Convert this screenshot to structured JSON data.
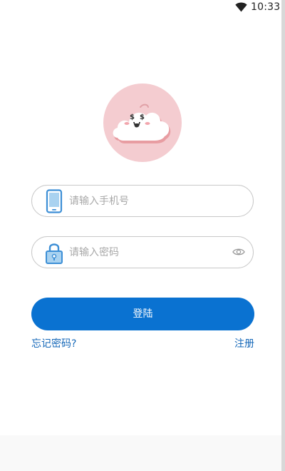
{
  "status_bar": {
    "time": "10:33",
    "wifi_icon": "wifi-icon"
  },
  "logo": {
    "icon": "cloud-mascot-logo",
    "circle_color": "#f4ccd0"
  },
  "phone_field": {
    "icon": "phone-icon",
    "placeholder": "请输入手机号",
    "value": ""
  },
  "password_field": {
    "icon": "lock-icon",
    "placeholder": "请输入密码",
    "value": "",
    "toggle_icon": "eye-icon"
  },
  "login_button": {
    "label": "登陆",
    "color": "#0a72d1"
  },
  "links": {
    "forgot_password": "忘记密码?",
    "register": "注册",
    "color": "#1467b8"
  },
  "theme": {
    "accent": "#0a72d1",
    "icon_blue": "#3d8fd6"
  }
}
